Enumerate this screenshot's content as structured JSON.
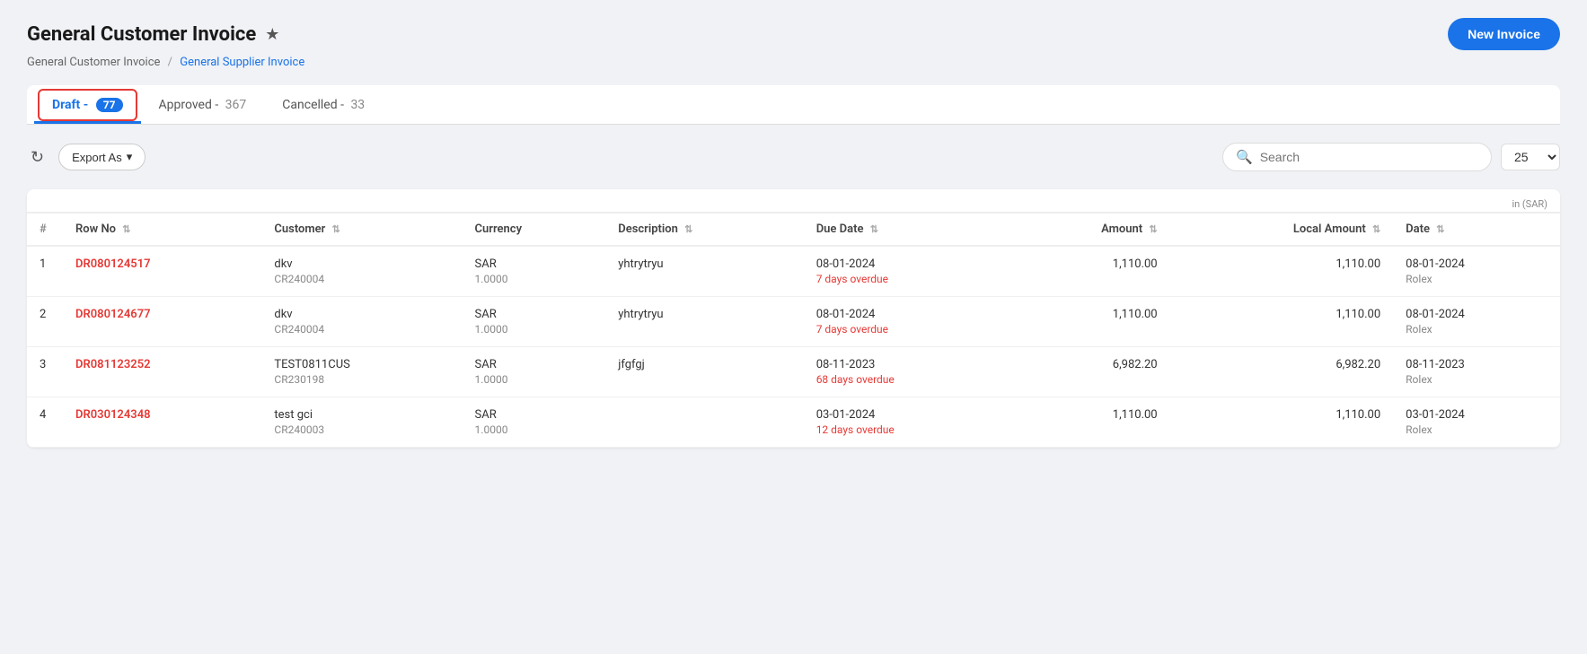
{
  "page": {
    "title": "General Customer Invoice",
    "star": "★",
    "new_invoice_label": "New Invoice"
  },
  "breadcrumb": {
    "current": "General Customer Invoice",
    "link_text": "General Supplier Invoice",
    "separator": "/"
  },
  "tabs": [
    {
      "id": "draft",
      "label": "Draft",
      "count": "77",
      "has_badge": true,
      "active": true
    },
    {
      "id": "approved",
      "label": "Approved",
      "count": "367",
      "has_badge": false,
      "active": false
    },
    {
      "id": "cancelled",
      "label": "Cancelled",
      "count": "33",
      "has_badge": false,
      "active": false
    }
  ],
  "toolbar": {
    "export_label": "Export As",
    "search_placeholder": "Search",
    "per_page": "25"
  },
  "table": {
    "in_sar_label": "in (SAR)",
    "columns": [
      {
        "id": "hash",
        "label": "#",
        "sortable": false
      },
      {
        "id": "row_no",
        "label": "Row No",
        "sortable": true
      },
      {
        "id": "customer",
        "label": "Customer",
        "sortable": true
      },
      {
        "id": "currency",
        "label": "Currency",
        "sortable": false
      },
      {
        "id": "description",
        "label": "Description",
        "sortable": true
      },
      {
        "id": "due_date",
        "label": "Due Date",
        "sortable": true
      },
      {
        "id": "amount",
        "label": "Amount",
        "sortable": true
      },
      {
        "id": "local_amount",
        "label": "Local Amount",
        "sortable": true
      },
      {
        "id": "date",
        "label": "Date",
        "sortable": true
      }
    ],
    "rows": [
      {
        "num": "1",
        "row_no": "DR080124517",
        "customer_name": "dkv",
        "customer_cr": "CR240004",
        "currency": "SAR",
        "currency_rate": "1.0000",
        "description": "yhtrytryu",
        "due_date": "08-01-2024",
        "overdue": "7 days overdue",
        "amount": "1,110.00",
        "local_amount": "1,110.00",
        "date": "08-01-2024",
        "date_sub": "Rolex"
      },
      {
        "num": "2",
        "row_no": "DR080124677",
        "customer_name": "dkv",
        "customer_cr": "CR240004",
        "currency": "SAR",
        "currency_rate": "1.0000",
        "description": "yhtrytryu",
        "due_date": "08-01-2024",
        "overdue": "7 days overdue",
        "amount": "1,110.00",
        "local_amount": "1,110.00",
        "date": "08-01-2024",
        "date_sub": "Rolex"
      },
      {
        "num": "3",
        "row_no": "DR081123252",
        "customer_name": "TEST0811CUS",
        "customer_cr": "CR230198",
        "currency": "SAR",
        "currency_rate": "1.0000",
        "description": "jfgfgj",
        "due_date": "08-11-2023",
        "overdue": "68 days overdue",
        "amount": "6,982.20",
        "local_amount": "6,982.20",
        "date": "08-11-2023",
        "date_sub": "Rolex"
      },
      {
        "num": "4",
        "row_no": "DR030124348",
        "customer_name": "test gci",
        "customer_cr": "CR240003",
        "currency": "SAR",
        "currency_rate": "1.0000",
        "description": "",
        "due_date": "03-01-2024",
        "overdue": "12 days overdue",
        "amount": "1,110.00",
        "local_amount": "1,110.00",
        "date": "03-01-2024",
        "date_sub": "Rolex"
      }
    ]
  }
}
